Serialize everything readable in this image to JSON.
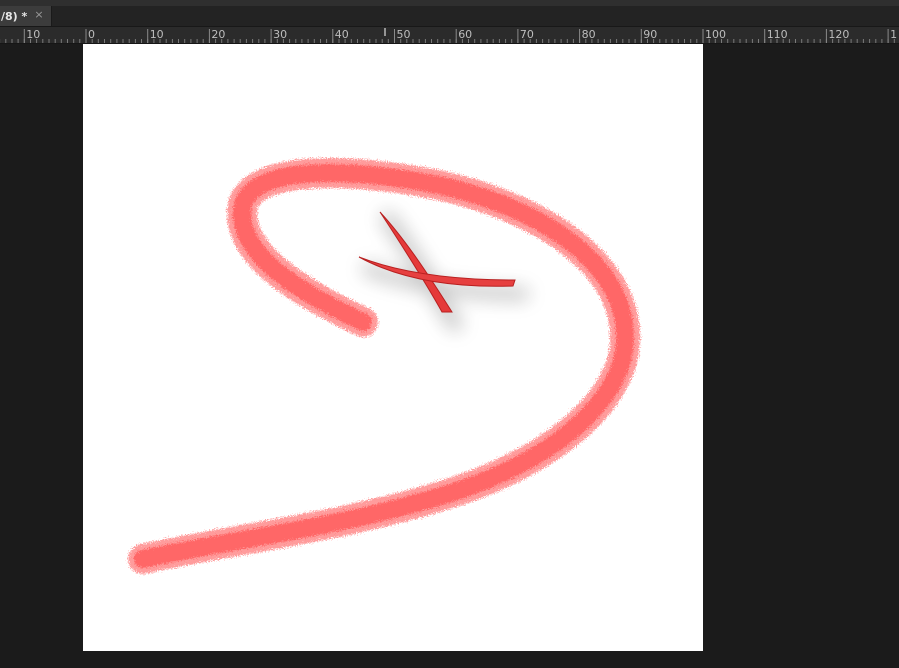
{
  "app": {
    "document_tab": {
      "title": "/8) *",
      "close_glyph": "×"
    },
    "ruler": {
      "unit_labels": [
        "10",
        "0",
        "10",
        "20",
        "30",
        "40",
        "50",
        "60",
        "70",
        "80",
        "90",
        "100",
        "110",
        "120",
        "1"
      ]
    },
    "canvas": {
      "background_color": "#ffffff",
      "stroke_color": "#ff2a2a",
      "x_mark_color": "#e53030"
    },
    "icons": {
      "close": "close-icon"
    }
  }
}
